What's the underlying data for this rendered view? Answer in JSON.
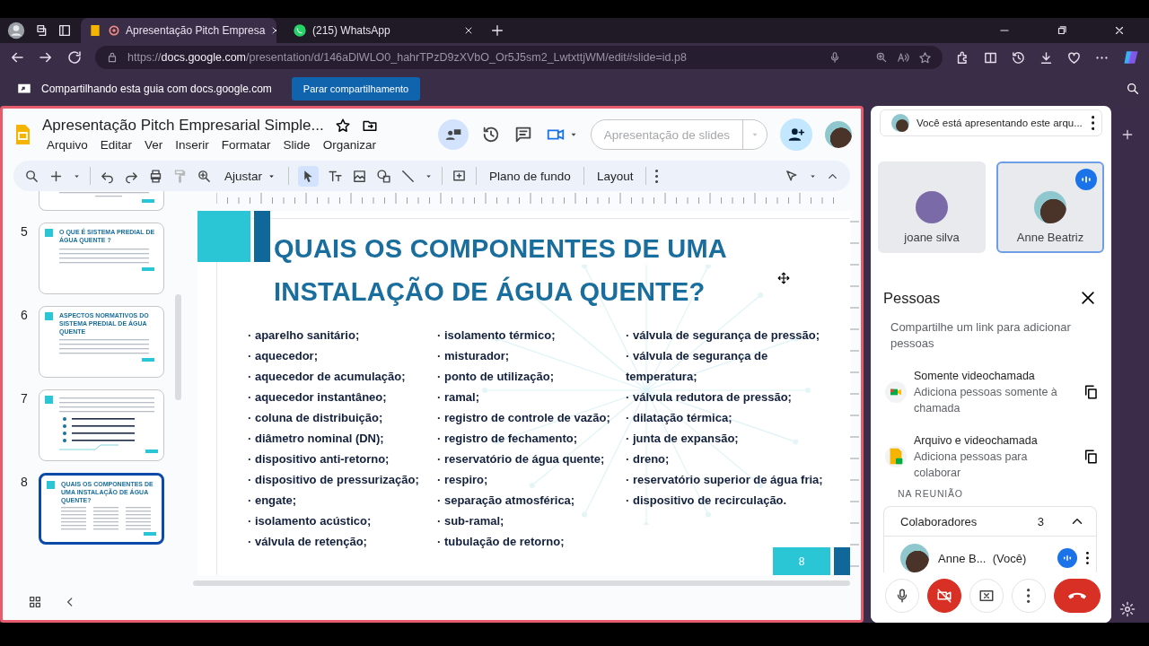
{
  "browser": {
    "tabs": [
      {
        "kind": "slides",
        "title": "Apresentação Pitch Empresa",
        "selected": true
      },
      {
        "kind": "whatsapp",
        "title": "(215) WhatsApp",
        "selected": false
      }
    ],
    "url": {
      "scheme": "https://",
      "host": "docs.google.com",
      "path": "/presentation/d/146aDlWLO0_hahrTPzD9zXVbO_Or5J5sm2_LwtxttjWM/edit#slide=id.p8"
    },
    "sharing": {
      "message": "Compartilhando esta guia com docs.google.com",
      "button": "Parar compartilhamento"
    }
  },
  "editor": {
    "title": "Apresentação Pitch Empresarial Simple...",
    "menu": [
      "Arquivo",
      "Editar",
      "Ver",
      "Inserir",
      "Formatar",
      "Slide",
      "Organizar"
    ],
    "present_button": "Apresentação de slides",
    "toolbar": {
      "zoom": "Ajustar",
      "background": "Plano de fundo",
      "layout": "Layout"
    }
  },
  "thumbnails": [
    {
      "kind": "partial",
      "selected": false
    },
    {
      "kind": "text",
      "number": "5",
      "title": "O QUE É SISTEMA PREDIAL DE ÁGUA QUENTE ?",
      "selected": false
    },
    {
      "kind": "text",
      "number": "6",
      "title": "ASPECTOS NORMATIVOS DO SISTEMA PREDIAL DE ÁGUA QUENTE",
      "selected": false
    },
    {
      "kind": "bullets",
      "number": "7",
      "selected": false
    },
    {
      "kind": "columns",
      "number": "8",
      "title": "QUAIS OS COMPONENTES DE UMA INSTALAÇÃO DE ÁGUA QUENTE?",
      "selected": true
    }
  ],
  "slide": {
    "title_lines": [
      "QUAIS OS COMPONENTES DE UMA",
      "INSTALAÇÃO DE ÁGUA QUENTE?"
    ],
    "columns": [
      [
        "· aparelho sanitário;",
        "· aquecedor;",
        "· aquecedor de acumulação;",
        "· aquecedor instantâneo;",
        "· coluna de distribuição;",
        "· diâmetro nominal (DN);",
        "· dispositivo anti-retorno;",
        "· dispositivo de pressurização;",
        "· engate;",
        "· isolamento acústico;",
        "· válvula de retenção;"
      ],
      [
        "· isolamento térmico;",
        "· misturador;",
        "· ponto de utilização;",
        "· ramal;",
        "· registro de controle de vazão;",
        "· registro de fechamento;",
        "· reservatório de água quente;",
        "· respiro;",
        "· separação atmosférica;",
        "· sub-ramal;",
        "· tubulação de retorno;"
      ],
      [
        "· válvula de segurança de pressão;",
        "· válvula de segurança de temperatura;",
        "· válvula redutora de pressão;",
        "· dilatação térmica;",
        "· junta de expansão;",
        "· dreno;",
        "· reservatório superior de água fria;",
        "· dispositivo de recirculação."
      ]
    ],
    "page_number": "8"
  },
  "meet": {
    "presenting": "Você está apresentando este arqu...",
    "participants": [
      {
        "name": "joane silva",
        "speaking": false
      },
      {
        "name": "Anne Beatriz",
        "speaking": true
      }
    ],
    "people": {
      "title": "Pessoas",
      "hint": "Compartilhe um link para adicionar pessoas",
      "options": [
        {
          "kind": "meet",
          "title": "Somente videochamada",
          "description": "Adiciona pessoas somente à chamada"
        },
        {
          "kind": "file",
          "title": "Arquivo e videochamada",
          "description": "Adiciona pessoas para colaborar"
        }
      ],
      "section": "NA REUNIÃO",
      "group": {
        "name": "Colaboradores",
        "count": "3",
        "expanded": true,
        "members": [
          {
            "name": "Anne B...",
            "tag": "(Você)",
            "speaking": true
          }
        ]
      }
    },
    "controls": [
      {
        "kind": "mic",
        "on": true
      },
      {
        "kind": "camera",
        "on": false
      },
      {
        "kind": "present"
      },
      {
        "kind": "more"
      },
      {
        "kind": "hangup"
      }
    ]
  }
}
